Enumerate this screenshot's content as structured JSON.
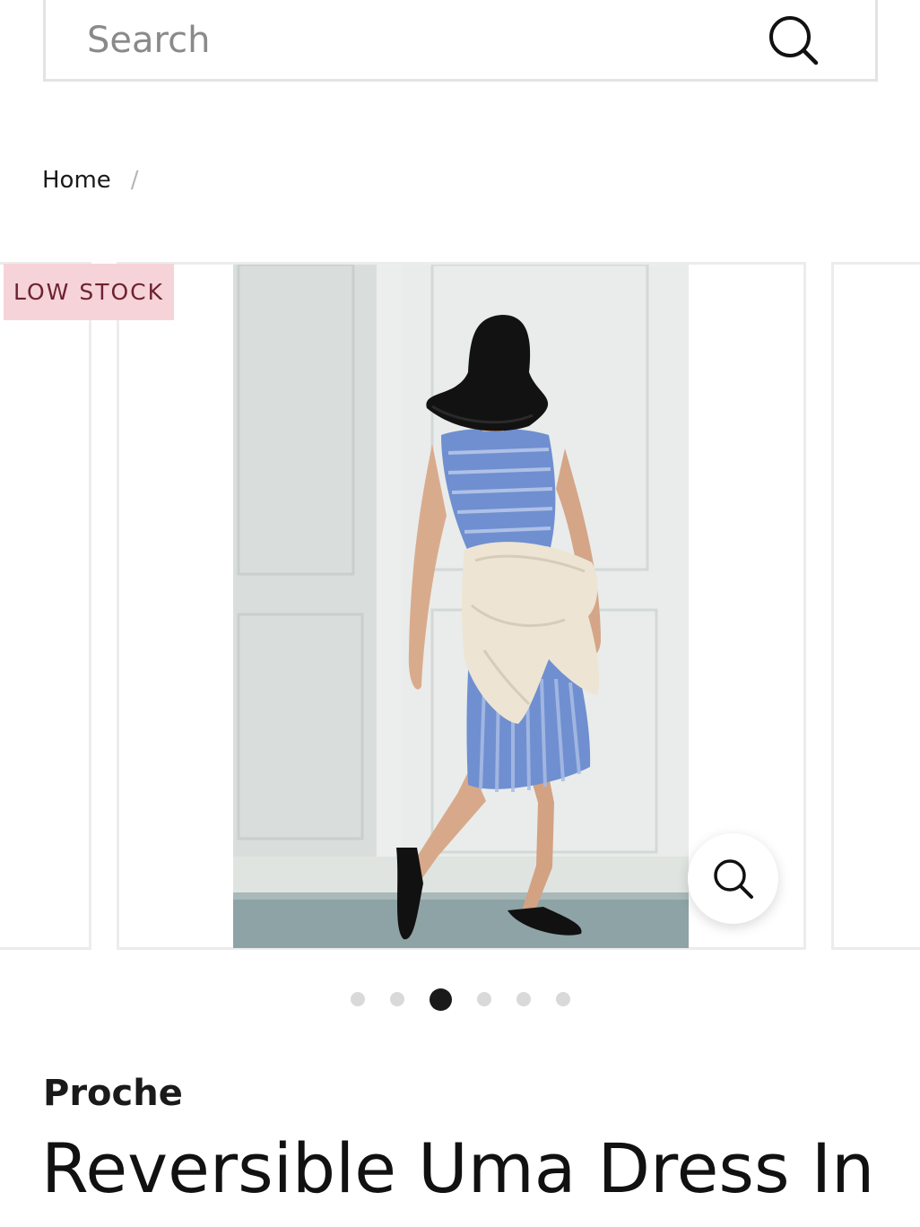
{
  "search": {
    "placeholder": "Search"
  },
  "breadcrumb": {
    "home": "Home",
    "separator": "/"
  },
  "gallery": {
    "badge": "LOW STOCK",
    "badge_color": "#f6d3d8",
    "dots_total": 6,
    "active_dot": 3,
    "zoom_icon": "zoom-icon"
  },
  "product": {
    "vendor": "Proche",
    "title": "Reversible Uma Dress In"
  }
}
